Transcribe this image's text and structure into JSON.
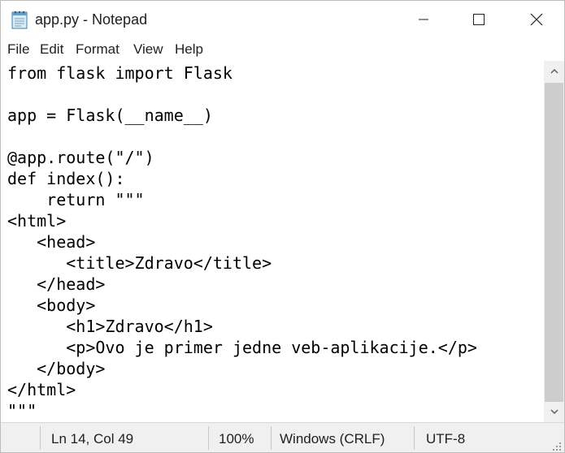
{
  "window": {
    "title": "app.py - Notepad"
  },
  "menu": {
    "file": "File",
    "edit": "Edit",
    "format": "Format",
    "view": "View",
    "help": "Help"
  },
  "editor": {
    "content": "from flask import Flask\n\napp = Flask(__name__)\n\n@app.route(\"/\")\ndef index():\n    return \"\"\"\n<html>\n   <head>\n      <title>Zdravo</title>\n   </head>\n   <body>\n      <h1>Zdravo</h1>\n      <p>Ovo je primer jedne veb-aplikacije.</p>\n   </body>\n</html>\n\"\"\""
  },
  "status": {
    "position": "Ln 14, Col 49",
    "zoom": "100%",
    "line_endings": "Windows (CRLF)",
    "encoding": "UTF-8"
  },
  "icons": {
    "app": "notepad-icon",
    "minimize": "minimize-icon",
    "maximize": "maximize-icon",
    "close": "close-icon",
    "scroll_up": "scroll-up-arrow-icon",
    "scroll_down": "scroll-down-arrow-icon",
    "resize": "resize-grip-icon"
  },
  "colors": {
    "titlebar": "#ffffff",
    "statusbar": "#f0f0f0",
    "scrollbar_thumb": "#cdcdcd"
  }
}
